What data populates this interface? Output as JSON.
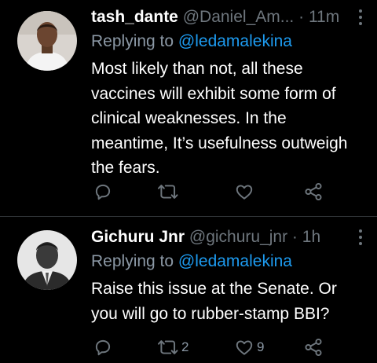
{
  "tweets": [
    {
      "author_name": "tash_dante",
      "author_handle": "@Daniel_Am...",
      "time": "11m",
      "replying_prefix": "Replying to ",
      "replying_to": "@ledamalekina",
      "text": "Most likely than not, all these vaccines will exhibit some form of clinical weaknesses. In the meantime, It’s usefulness outweigh the fears.",
      "retweet_count": "",
      "like_count": ""
    },
    {
      "author_name": "Gichuru Jnr",
      "author_handle": "@gichuru_jnr",
      "time": "1h",
      "replying_prefix": "Replying to ",
      "replying_to": "@ledamalekina",
      "text": "Raise this issue at the Senate. Or you will go to rubber-stamp BBI?",
      "retweet_count": "2",
      "like_count": "9"
    }
  ],
  "separator": " · ",
  "colors": {
    "background": "#000000",
    "muted": "#6e767d",
    "link": "#1d9bf0",
    "divider": "#2f3336"
  },
  "icons": [
    "more-vertical-icon",
    "reply-icon",
    "retweet-icon",
    "like-icon",
    "share-icon"
  ]
}
